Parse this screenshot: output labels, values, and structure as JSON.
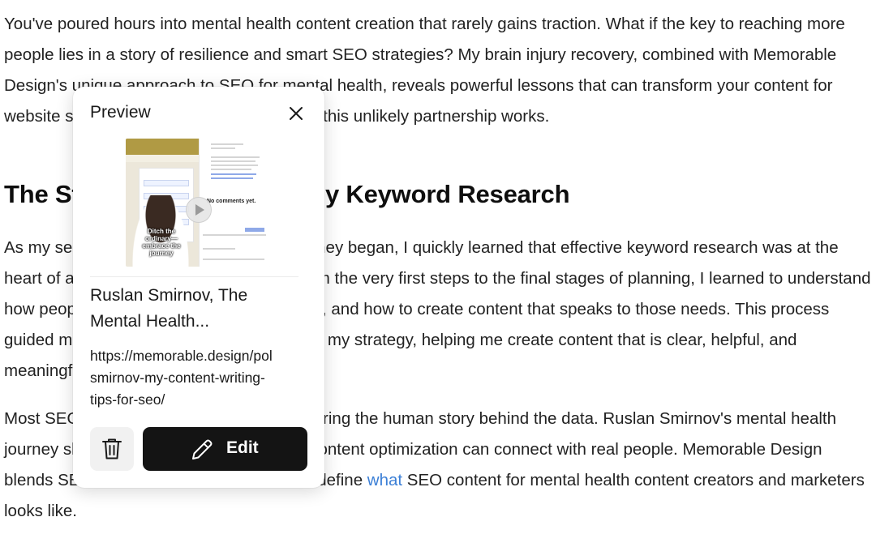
{
  "article": {
    "paragraph1": "You've poured hours into mental health content creation that rarely gains traction. What if the key to reaching more people lies in a story of resilience and smart SEO strategies? My brain injury recovery, combined with Memorable Design's unique approach to SEO for mental health, reveals powerful lessons that can transform your content for website success. Keep reading to see how this unlikely partnership works.",
    "heading": "The Strategic Strategy of My Keyword Research",
    "paragraph2": "As my search for healing and purpose journey began, I quickly learned that effective keyword research was at the heart of a meaningful content strategy. From the very first steps to the final stages of planning, I learned to understand how people search, what they struggle with, and how to create content that speaks to those needs. This process guided me through each step of developing my strategy, helping me create content that is clear, helpful, and meaningful from start to finish.",
    "paragraph3_part1": "Most SEO strategies miss the mark by ignoring the human story behind the data. Ruslan Smirnov's mental health journey shows how digital consulting and content optimization can connect with real people. Memorable Design blends SEO with real-world resilience to redefine ",
    "paragraph3_link": "what",
    "paragraph3_part2": " SEO content for mental health content creators and marketers looks like."
  },
  "preview": {
    "title": "Preview",
    "card_title": "Ruslan Smirnov, The Mental Health...",
    "url": "https://memorable.design/portfolio/ruslan-smirnov-my-content-writing-tips-for-seo/",
    "url_display": "https://memorable.design/pol\nsmirnov-my-content-writing-\ntips-for-seo/",
    "edit_label": "Edit",
    "thumbnail": {
      "caption": "Ditch the ordinary—embrace the journey",
      "no_comments": "No comments yet."
    }
  },
  "colors": {
    "link": "#3b7fd6",
    "edit_button_bg": "#141414",
    "delete_button_bg": "#f1f1f1"
  },
  "icons": {
    "close": "close-icon",
    "delete": "trash-icon",
    "edit": "pencil-icon",
    "play": "play-icon"
  }
}
